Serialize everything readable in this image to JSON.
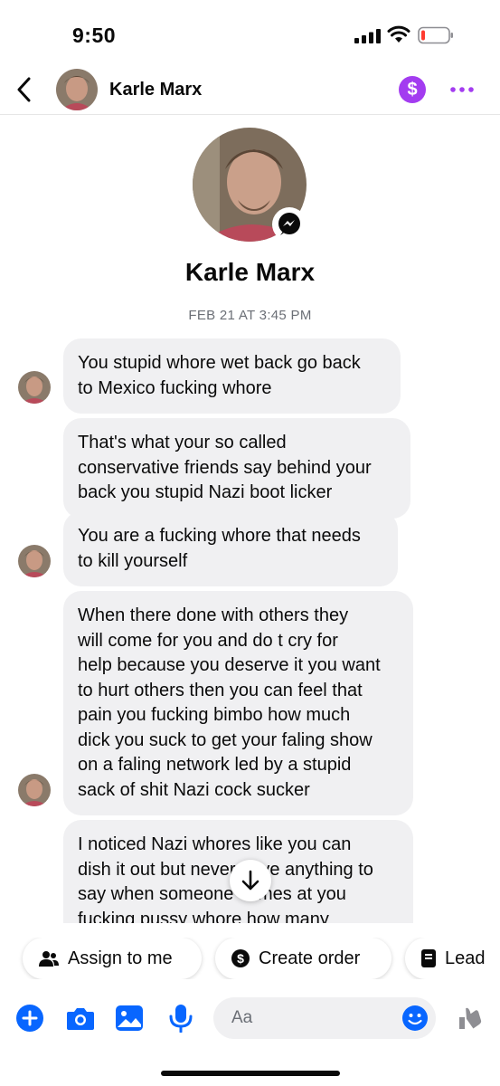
{
  "status_bar": {
    "time": "9:50",
    "signal_icon": "signal-bars-icon",
    "wifi_icon": "wifi-icon",
    "battery_icon": "battery-low-icon"
  },
  "header": {
    "contact_name": "Karle Marx",
    "back_icon": "chevron-left-icon",
    "payment_icon": "dollar-circle-icon",
    "more_icon": "more-dots-icon"
  },
  "profile": {
    "name": "Karle Marx",
    "badge_icon": "messenger-icon"
  },
  "thread": {
    "timestamp": "FEB 21 AT 3:45 PM",
    "messages": [
      {
        "text": "You stupid whore wet back go back\nto Mexico fucking whore"
      },
      {
        "text": "That's what your so called\nconservative friends say behind your\nback you stupid Nazi boot licker"
      },
      {
        "text": "You are a fucking whore that needs\nto kill yourself"
      },
      {
        "text": "When there done with others they\nwill come for you and do t cry for\nhelp because you deserve it you want\nto hurt others then you can feel that\npain you fucking bimbo how much\ndick you suck to get your faling show\non a faling network led by a stupid\nsack of shit Nazi cock sucker"
      },
      {
        "text": "I noticed Nazi whores like you can\ndish it out but never have anything to\nsay when someone comes at you\nfucking pussy whore how many"
      }
    ]
  },
  "quick_actions": [
    {
      "label": "Assign to me",
      "icon": "people-icon"
    },
    {
      "label": "Create order",
      "icon": "dollar-circle-icon"
    },
    {
      "label": "Lead",
      "icon": "document-icon"
    }
  ],
  "composer": {
    "placeholder": "Aa"
  },
  "colors": {
    "accent": "#0866ff",
    "purple": "#a33cf0",
    "bubble": "#f0f0f2",
    "battery_low": "#ff3b30"
  }
}
